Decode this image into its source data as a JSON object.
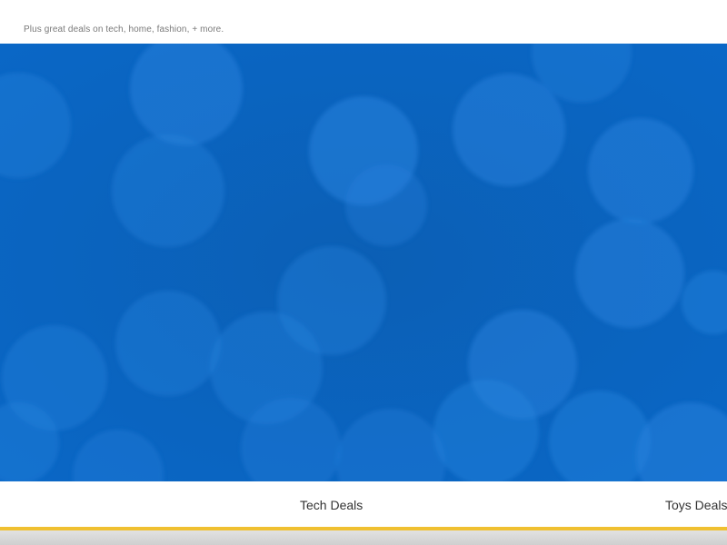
{
  "promo": {
    "subtitle": "Plus great deals on tech, home, fashion, + more."
  },
  "hero": {
    "background_color": "#0a66c2",
    "bokeh_color": "#2a86e0"
  },
  "tabs": [
    {
      "label": "Tech Deals"
    },
    {
      "label": "Toys Deals"
    }
  ],
  "colors": {
    "accent": "#f0c030",
    "tab_text": "#333333",
    "subtitle_text": "#7a7a7a"
  }
}
